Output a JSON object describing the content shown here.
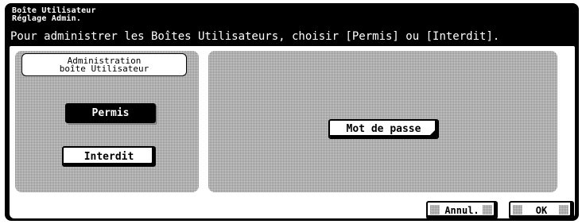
{
  "header": {
    "title_line1": "Boîte Utilisateur",
    "title_line2": "Réglage Admin.",
    "message": "Pour administrer les Boîtes Utilisateurs, choisir [Permis] ou [Interdit]."
  },
  "left_panel": {
    "group_label_line1": "Administration",
    "group_label_line2": "boîte Utilisateur",
    "permis_label": "Permis",
    "permis_selected": true,
    "interdit_label": "Interdit"
  },
  "right_panel": {
    "password_label": "Mot de passe"
  },
  "footer": {
    "cancel_label": "Annul.",
    "ok_label": "OK"
  }
}
